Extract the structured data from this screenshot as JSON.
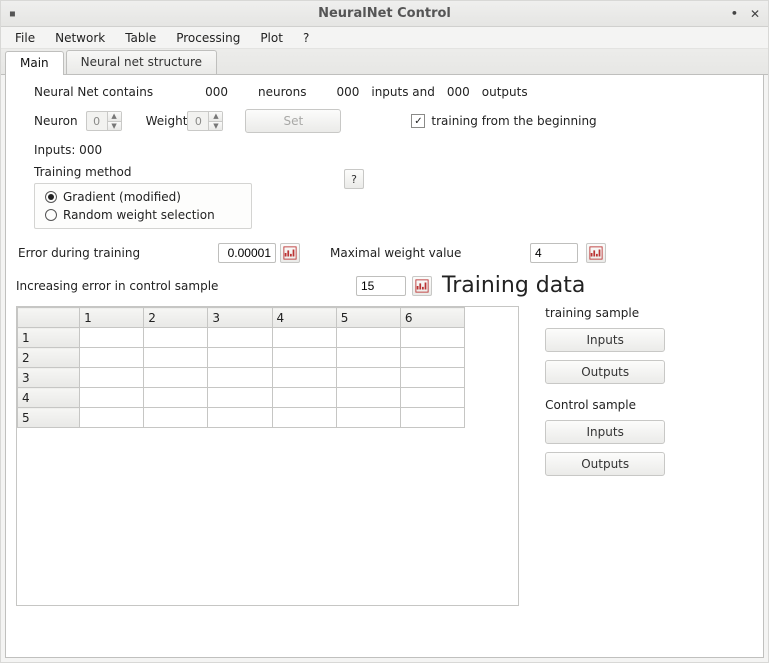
{
  "window": {
    "title": "NeuralNet Control"
  },
  "menu": {
    "file": "File",
    "network": "Network",
    "table": "Table",
    "processing": "Processing",
    "plot": "Plot",
    "help": "?"
  },
  "tabs": {
    "main": "Main",
    "structure": "Neural net structure"
  },
  "summary": {
    "prefix": "Neural Net contains",
    "neurons_val": "000",
    "neurons_lbl": "neurons",
    "inputs_val": "000",
    "inputs_lbl": "inputs and",
    "outputs_val": "000",
    "outputs_lbl": "outputs"
  },
  "neuron": {
    "label": "Neuron",
    "value": "0"
  },
  "weight": {
    "label": "Weight",
    "value": "0"
  },
  "set_btn": "Set",
  "training_from_beginning": {
    "label": "training from the beginning",
    "checked": true
  },
  "inputs_line": "Inputs: 000",
  "training_method": {
    "label": "Training method",
    "opt1": "Gradient (modified)",
    "opt2": "Random weight selection"
  },
  "help_btn": "?",
  "error_training": {
    "label": "Error during training",
    "value": "0.00001"
  },
  "max_weight": {
    "label": "Maximal weight value",
    "value": "4"
  },
  "inc_error": {
    "label": "Increasing error in control sample",
    "value": "15"
  },
  "training_data_heading": "Training data",
  "table": {
    "cols": [
      "1",
      "2",
      "3",
      "4",
      "5",
      "6"
    ],
    "rows": [
      "1",
      "2",
      "3",
      "4",
      "5"
    ]
  },
  "side": {
    "training_sample": "training sample",
    "control_sample": "Control sample",
    "inputs": "Inputs",
    "outputs": "Outputs"
  }
}
